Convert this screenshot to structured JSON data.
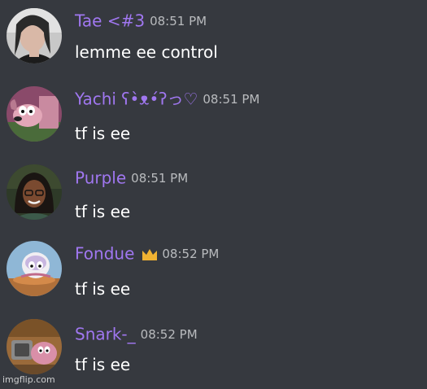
{
  "messages": [
    {
      "author": "Tae <#3",
      "time": "08:51 PM",
      "text": "lemme ee control",
      "avatar_icon": "user-avatar-photo"
    },
    {
      "author": "Yachi ʕ•̀ᴥ•́ʔっ♡",
      "time": "08:51 PM",
      "text": "tf is ee",
      "avatar_icon": "cartoon-dog-avatar"
    },
    {
      "author": "Purple",
      "time": "08:51 PM",
      "text": "tf is ee",
      "avatar_icon": "user-avatar-photo"
    },
    {
      "author": "Fondue",
      "time": "08:52 PM",
      "text": "tf is ee",
      "avatar_icon": "cartoon-dog-avatar",
      "badge": "crown-icon"
    },
    {
      "author": "Snark-_",
      "time": "08:52 PM",
      "text": "tf is ee",
      "avatar_icon": "cartoon-dog-avatar"
    }
  ],
  "colors": {
    "background": "#36393f",
    "username": "#a077f0",
    "timestamp": "#b9bbbe",
    "message_text": "#ffffff",
    "crown": "#f0b232"
  },
  "watermark": "imgflip.com"
}
